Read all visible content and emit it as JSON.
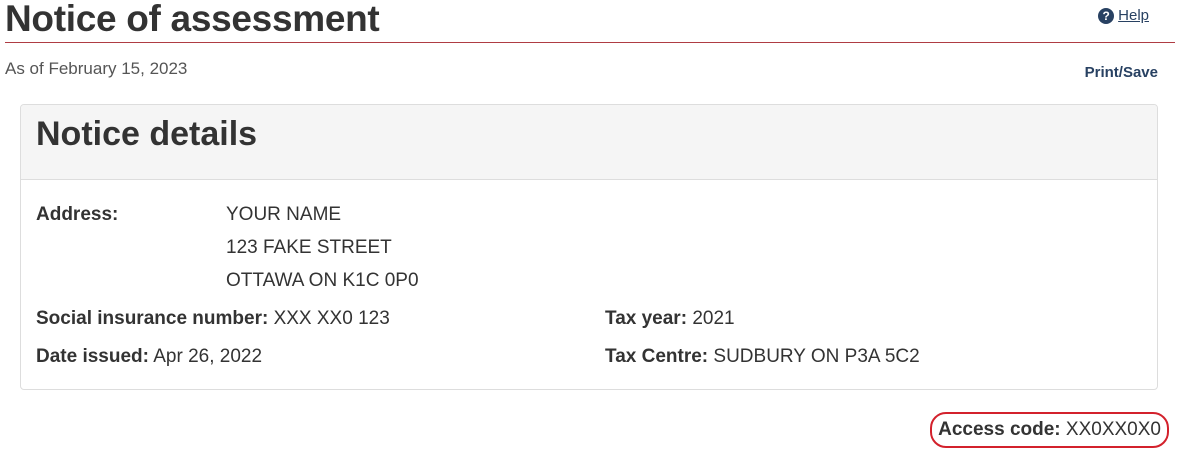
{
  "header": {
    "title": "Notice of assessment",
    "help_label": "Help",
    "help_icon": "?",
    "as_of": "As of February 15, 2023",
    "print_save_label": "Print/Save"
  },
  "panel": {
    "heading": "Notice details",
    "address_label": "Address:",
    "address_lines": [
      "YOUR NAME",
      "123 FAKE STREET",
      "OTTAWA ON K1C 0P0"
    ],
    "sin_label": "Social insurance number:",
    "sin_value": "XXX XX0 123",
    "date_issued_label": "Date issued:",
    "date_issued_value": "Apr 26, 2022",
    "tax_year_label": "Tax year:",
    "tax_year_value": "2021",
    "tax_centre_label": "Tax Centre:",
    "tax_centre_value": "SUDBURY ON P3A 5C2"
  },
  "access": {
    "label": "Access code:",
    "value": "XX0XX0X0"
  },
  "colors": {
    "accent_rule": "#af3c43",
    "link": "#284162",
    "highlight_circle": "#d3212c"
  }
}
